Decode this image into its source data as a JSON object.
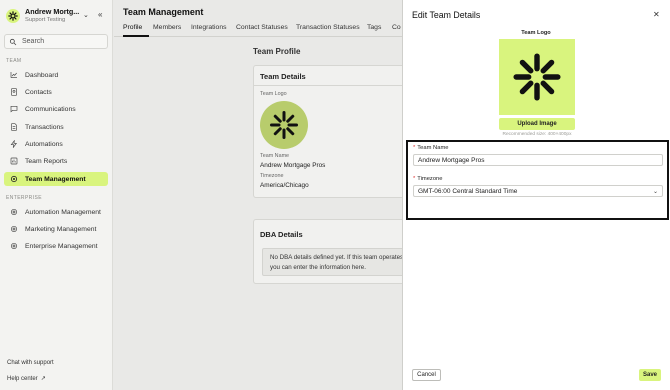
{
  "sidebar": {
    "org_name": "Andrew Mortg...",
    "org_subtitle": "Support Testing",
    "search_label": "Search",
    "section_team": "TEAM",
    "section_enterprise": "ENTERPRISE",
    "items": [
      {
        "label": "Dashboard",
        "icon": "chart-icon"
      },
      {
        "label": "Contacts",
        "icon": "contacts-icon"
      },
      {
        "label": "Communications",
        "icon": "chat-icon"
      },
      {
        "label": "Transactions",
        "icon": "document-icon"
      },
      {
        "label": "Automations",
        "icon": "bolt-icon"
      },
      {
        "label": "Team Reports",
        "icon": "report-icon"
      },
      {
        "label": "Team Management",
        "icon": "gear-icon",
        "active": true
      },
      {
        "label": "Automation Management",
        "icon": "gear-icon"
      },
      {
        "label": "Marketing Management",
        "icon": "gear-icon"
      },
      {
        "label": "Enterprise Management",
        "icon": "gear-icon"
      }
    ],
    "chat_support": "Chat with support",
    "help_center": "Help center"
  },
  "main": {
    "title": "Team Management",
    "tabs": [
      "Profile",
      "Members",
      "Integrations",
      "Contact Statuses",
      "Transaction Statuses",
      "Tags",
      "Co"
    ],
    "profile_title": "Team Profile",
    "team_details": {
      "heading": "Team Details",
      "logo_label": "Team Logo",
      "name_label": "Team Name",
      "name_value": "Andrew Mortgage Pros",
      "timezone_label": "Timezone",
      "timezone_value": "America/Chicago"
    },
    "dba": {
      "heading": "DBA Details",
      "line1": "No DBA details defined yet. If this team operates",
      "line2": "you can enter the information here."
    }
  },
  "panel": {
    "title": "Edit Team Details",
    "logo_label": "Team Logo",
    "upload_label": "Upload Image",
    "recommended": "Recommended size: 400×400px",
    "name_label": "Team Name",
    "name_value": "Andrew Mortgage Pros",
    "timezone_label": "Timezone",
    "timezone_value": "GMT-06:00 Central Standard Time",
    "cancel": "Cancel",
    "save": "Save"
  },
  "colors": {
    "accent": "#d9f47e",
    "logo_muted": "#b8cc6c"
  }
}
